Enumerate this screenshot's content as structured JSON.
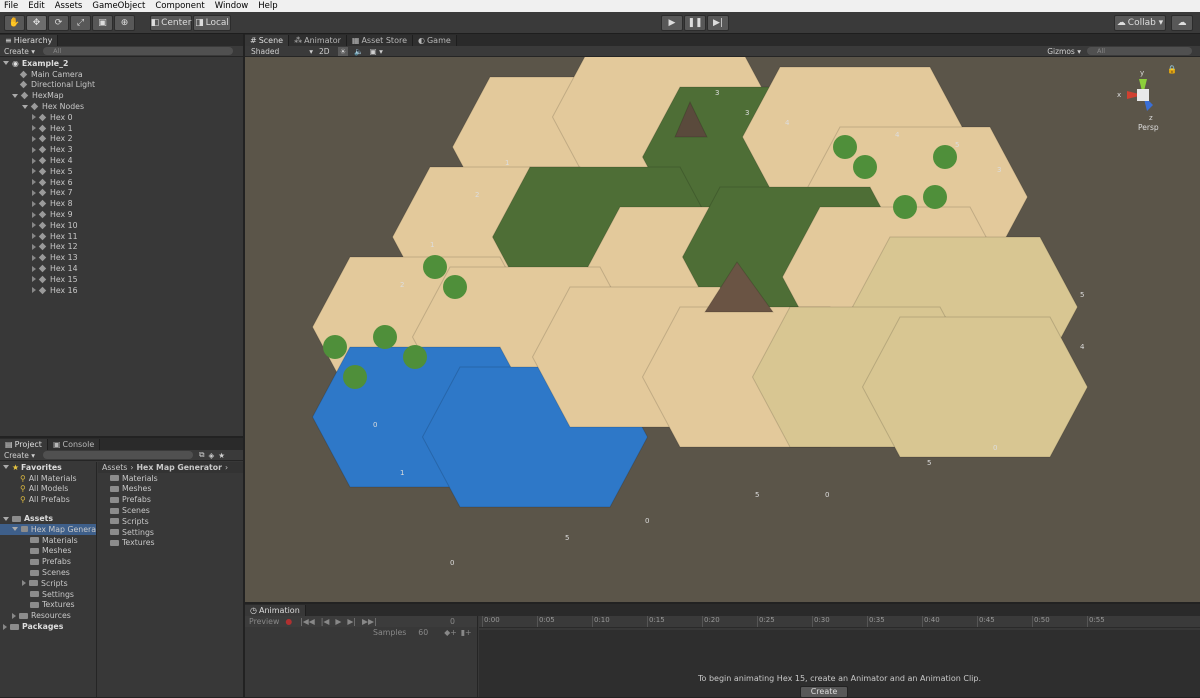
{
  "menu": [
    "File",
    "Edit",
    "Assets",
    "GameObject",
    "Component",
    "Window",
    "Help"
  ],
  "toolbar": {
    "center": "Center",
    "local": "Local",
    "collab": "Collab ▾"
  },
  "hierarchy": {
    "tab": "Hierarchy",
    "create": "Create ▾",
    "search_placeholder": "All",
    "scene": "Example_2",
    "items": [
      "Main Camera",
      "Directional Light",
      "HexMap",
      "Hex Nodes"
    ],
    "hexes": [
      "Hex 0",
      "Hex 1",
      "Hex 2",
      "Hex 3",
      "Hex 4",
      "Hex 5",
      "Hex 6",
      "Hex 7",
      "Hex 8",
      "Hex 9",
      "Hex 10",
      "Hex 11",
      "Hex 12",
      "Hex 13",
      "Hex 14",
      "Hex 15",
      "Hex 16"
    ]
  },
  "scene": {
    "tabs": [
      "Scene",
      "Animator",
      "Asset Store",
      "Game"
    ],
    "shading": "Shaded",
    "mode2d": "2D",
    "gizmos": "Gizmos ▾",
    "search_placeholder": "All",
    "persp": "Persp",
    "labels": [
      "1",
      "2",
      "1",
      "2",
      "0",
      "1",
      "0",
      "5",
      "0",
      "5",
      "0",
      "5",
      "0",
      "5",
      "4",
      "5",
      "3",
      "4",
      "3",
      "4",
      "3"
    ]
  },
  "project": {
    "tabs": [
      "Project",
      "Console"
    ],
    "create": "Create ▾",
    "favorites": "Favorites",
    "fav_items": [
      "All Materials",
      "All Models",
      "All Prefabs"
    ],
    "assets": "Assets",
    "asset_tree": [
      "Hex Map Genera",
      "Materials",
      "Meshes",
      "Prefabs",
      "Scenes",
      "Scripts",
      "Settings",
      "Textures",
      "Resources"
    ],
    "packages": "Packages",
    "breadcrumb": [
      "Assets",
      "Hex Map Generator"
    ],
    "folders": [
      "Materials",
      "Meshes",
      "Prefabs",
      "Scenes",
      "Scripts",
      "Settings",
      "Textures"
    ]
  },
  "animation": {
    "tab": "Animation",
    "preview": "Preview",
    "frame": "0",
    "samples_label": "Samples",
    "samples": "60",
    "ticks": [
      "0:00",
      "0:05",
      "0:10",
      "0:15",
      "0:20",
      "0:25",
      "0:30",
      "0:35",
      "0:40",
      "0:45",
      "0:50",
      "0:55"
    ],
    "message": "To begin animating Hex 15, create an Animator and an Animation Clip.",
    "create_button": "Create"
  }
}
